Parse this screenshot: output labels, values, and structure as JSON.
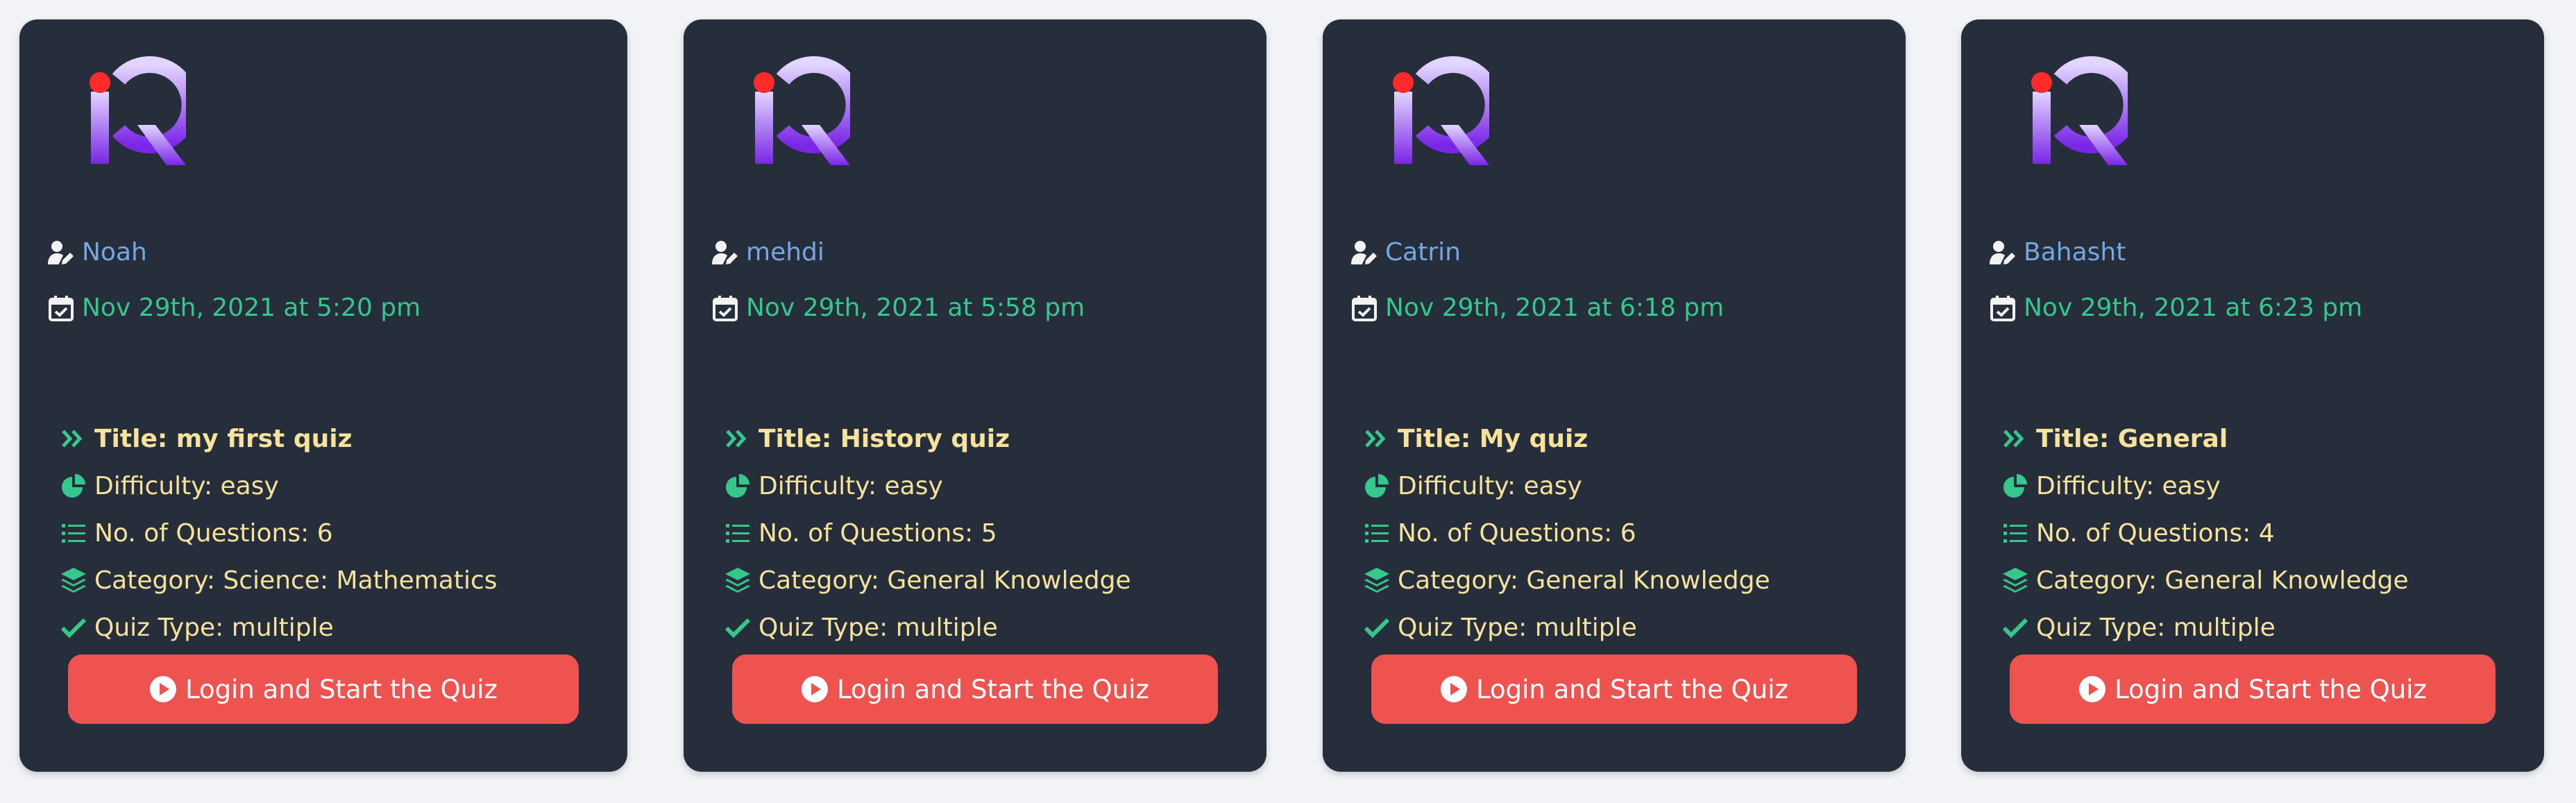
{
  "colors": {
    "card_bg": "#262d3b",
    "author": "#74a7e4",
    "date": "#35c88d",
    "details": "#f6e29a",
    "detail_icon": "#35c88d",
    "button": "#ef5350",
    "logo_gradient": [
      "#d7c8ff",
      "#7b2be6"
    ],
    "logo_dot": "#ff2a2a"
  },
  "icons": {
    "author": "user-pen-icon",
    "date": "calendar-check-icon",
    "title": "double-chevron-right-icon",
    "difficulty": "pie-chart-icon",
    "questions": "list-icon",
    "category": "layers-icon",
    "type": "check-icon",
    "button": "play-circle-icon"
  },
  "quizzes": [
    {
      "author": "Noah",
      "date": "Nov 29th, 2021 at 5:20 pm",
      "title": "Title: my first quiz",
      "difficulty": "Difficulty: easy",
      "questions": "No. of Questions: 6",
      "category": "Category: Science: Mathematics",
      "type": "Quiz Type: multiple",
      "button": "Login and Start the Quiz"
    },
    {
      "author": "mehdi",
      "date": "Nov 29th, 2021 at 5:58 pm",
      "title": "Title: History quiz",
      "difficulty": "Difficulty: easy",
      "questions": "No. of Questions: 5",
      "category": "Category: General Knowledge",
      "type": "Quiz Type: multiple",
      "button": "Login and Start the Quiz"
    },
    {
      "author": "Catrin",
      "date": "Nov 29th, 2021 at 6:18 pm",
      "title": "Title: My quiz",
      "difficulty": "Difficulty: easy",
      "questions": "No. of Questions: 6",
      "category": "Category: General Knowledge",
      "type": "Quiz Type: multiple",
      "button": "Login and Start the Quiz"
    },
    {
      "author": "Bahasht",
      "date": "Nov 29th, 2021 at 6:23 pm",
      "title": "Title: General",
      "difficulty": "Difficulty: easy",
      "questions": "No. of Questions: 4",
      "category": "Category: General Knowledge",
      "type": "Quiz Type: multiple",
      "button": "Login and Start the Quiz"
    }
  ]
}
